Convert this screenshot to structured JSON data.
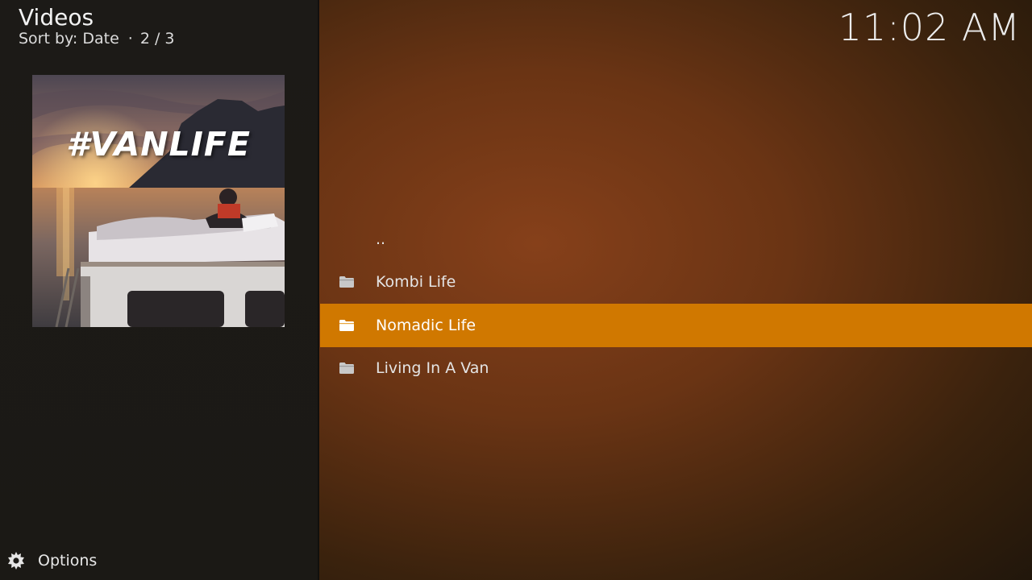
{
  "header": {
    "title": "Videos",
    "sort_label": "Sort by: Date",
    "separator": "·",
    "position": "2 / 3",
    "clock": "11:02 AM"
  },
  "thumbnail": {
    "overlay_text": "#VANLIFE"
  },
  "list": {
    "items": [
      {
        "label": "..",
        "icon": "none",
        "selected": false
      },
      {
        "label": "Kombi Life",
        "icon": "folder-icon",
        "selected": false
      },
      {
        "label": "Nomadic Life",
        "icon": "folder-icon",
        "selected": true
      },
      {
        "label": "Living In A Van",
        "icon": "folder-icon",
        "selected": false
      }
    ]
  },
  "footer": {
    "options_label": "Options",
    "options_icon": "gear-icon"
  },
  "colors": {
    "highlight": "#d07800",
    "background": "#6a3414",
    "sidebar": "#1c1a17"
  }
}
